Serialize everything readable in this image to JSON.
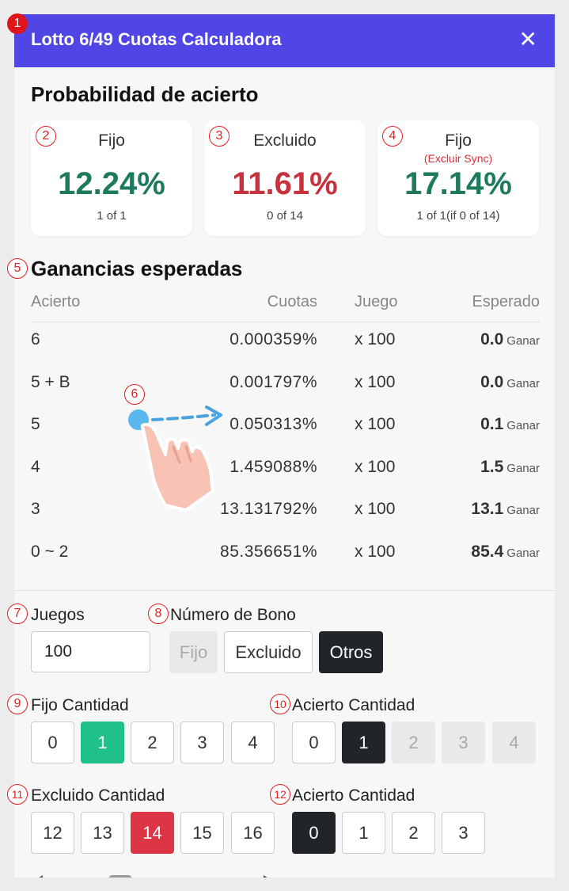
{
  "dialog": {
    "title": "Lotto 6/49 Cuotas Calculadora",
    "close_label": "✕"
  },
  "probability": {
    "title": "Probabilidad de acierto",
    "cards": [
      {
        "label": "Fijo",
        "sub": "",
        "percent": "12.24%",
        "count": "1 of 1"
      },
      {
        "label": "Excluido",
        "sub": "",
        "percent": "11.61%",
        "count": "0 of 14"
      },
      {
        "label": "Fijo",
        "sub": "(Excluir Sync)",
        "percent": "17.14%",
        "count": "1 of 1(if 0 of 14)"
      }
    ]
  },
  "earnings": {
    "title": "Ganancias esperadas",
    "headers": [
      "Acierto",
      "Cuotas",
      "Juego",
      "Esperado"
    ],
    "rows": [
      {
        "match": "6",
        "odds": "0.000359%",
        "game": "x 100",
        "expected": "0.0",
        "unit": "Ganar"
      },
      {
        "match": "5 + B",
        "odds": "0.001797%",
        "game": "x 100",
        "expected": "0.0",
        "unit": "Ganar"
      },
      {
        "match": "5",
        "odds": "0.050313%",
        "game": "x 100",
        "expected": "0.1",
        "unit": "Ganar"
      },
      {
        "match": "4",
        "odds": "1.459088%",
        "game": "x 100",
        "expected": "1.5",
        "unit": "Ganar"
      },
      {
        "match": "3",
        "odds": "13.131792%",
        "game": "x 100",
        "expected": "13.1",
        "unit": "Ganar"
      },
      {
        "match": "0 ~ 2",
        "odds": "85.356651%",
        "game": "x 100",
        "expected": "85.4",
        "unit": "Ganar"
      }
    ]
  },
  "games": {
    "label": "Juegos",
    "value": "100"
  },
  "bonus": {
    "label": "Número de Bono",
    "options": [
      "Fijo",
      "Excluido",
      "Otros"
    ],
    "selected": "Otros"
  },
  "fixed_count": {
    "label": "Fijo Cantidad",
    "options": [
      "0",
      "1",
      "2",
      "3",
      "4"
    ],
    "selected": "1"
  },
  "hit_count_1": {
    "label": "Acierto Cantidad",
    "options": [
      "0",
      "1",
      "2",
      "3",
      "4"
    ],
    "selected": "1"
  },
  "excluded_count": {
    "label": "Excluido Cantidad",
    "options": [
      "12",
      "13",
      "14",
      "15",
      "16"
    ],
    "selected": "14"
  },
  "hit_count_2": {
    "label": "Acierto Cantidad",
    "options": [
      "0",
      "1",
      "2",
      "3"
    ],
    "selected": "0"
  },
  "badges": [
    "1",
    "2",
    "3",
    "4",
    "5",
    "6",
    "7",
    "8",
    "9",
    "10",
    "11",
    "12"
  ],
  "icons": {
    "close": "close-icon",
    "gesture": "swipe-hand-icon",
    "scroll_left": "arrow-left-icon",
    "scroll_right": "arrow-right-icon"
  },
  "colors": {
    "header": "#4f46e5",
    "positive": "#1e7a5c",
    "negative": "#c8323e",
    "selected_green": "#20c08a",
    "selected_red": "#dc3545",
    "selected_dark": "#212529"
  }
}
